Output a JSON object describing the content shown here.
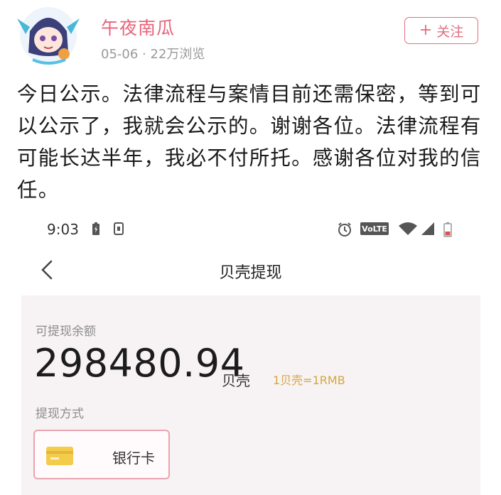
{
  "post": {
    "username": "午夜南瓜",
    "date": "05-06",
    "separator": "·",
    "views": "22万浏览",
    "follow_label": "关注",
    "follow_icon": "plus-icon",
    "avatar_icon": "anime-avatar-icon",
    "text": "今日公示。法律流程与案情目前还需保密，等到可以公示了，我就会公示的。谢谢各位。法律流程有可能长达半年，我必不付所托。感谢各位对我的信任。"
  },
  "phone": {
    "status_bar": {
      "time": "9:03",
      "volte_label": "VoLTE",
      "icons": [
        "battery-charging-icon",
        "notification-icon",
        "alarm-icon",
        "volte-icon",
        "wifi-icon",
        "signal-icon",
        "battery-icon"
      ]
    },
    "nav": {
      "back_icon": "chevron-left-icon",
      "title": "贝壳提现"
    },
    "balance": {
      "label": "可提现余额",
      "amount": "298480.94",
      "unit": "贝壳",
      "rate_note": "1贝壳=1RMB"
    },
    "withdraw_method": {
      "label": "提现方式",
      "option_label": "银行卡",
      "option_icon": "bank-card-icon"
    }
  },
  "colors": {
    "username": "#e8627a",
    "follow_border": "#e0707f",
    "rate_note": "#d6a640",
    "card_bg": "#f7f3f4",
    "method_border": "#e9a3b0",
    "bank_icon": "#f4cc4b"
  }
}
